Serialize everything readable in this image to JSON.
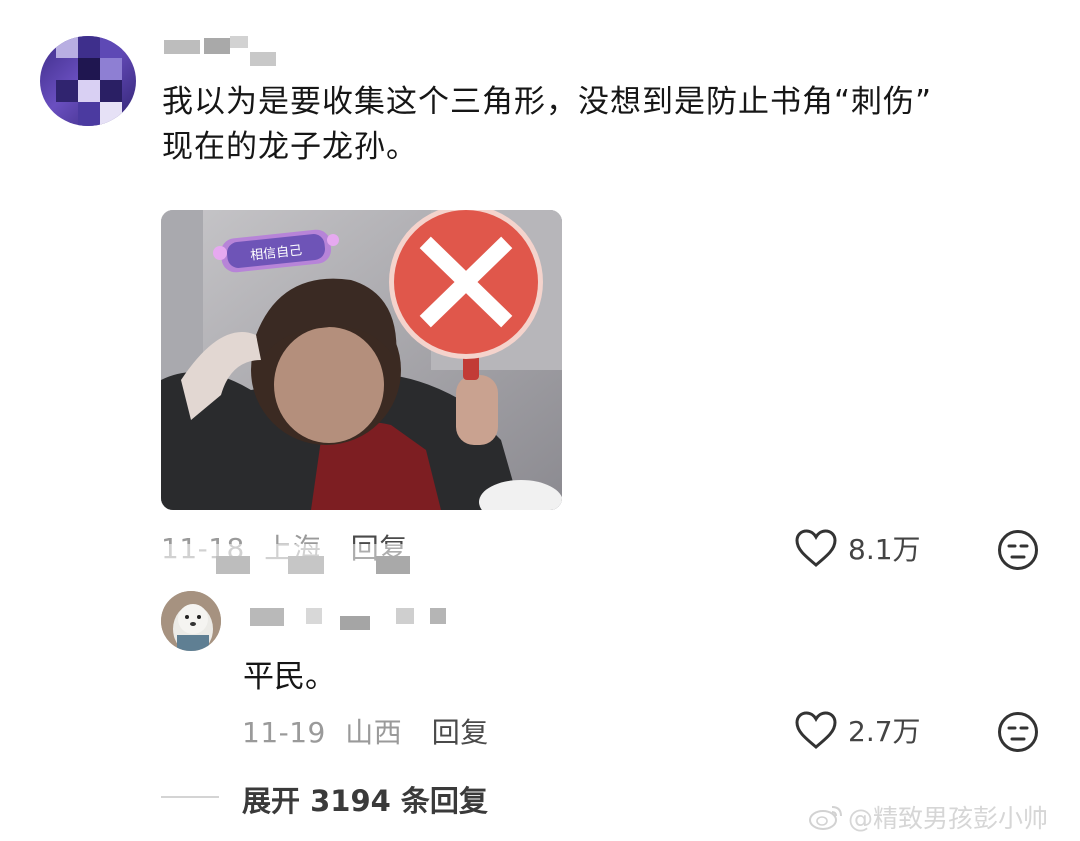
{
  "comment": {
    "text_line1": "我以为是要收集这个三角形，没想到是防止书角“刺伤”",
    "text_line2": "现在的龙子龙孙。",
    "date": "11-18",
    "location": "上海",
    "reply_label": "回复",
    "likes": "8.1万",
    "photo_badge_text": "相信自己"
  },
  "reply": {
    "text": "平民。",
    "date": "11-19",
    "location": "山西",
    "reply_label": "回复",
    "likes": "2.7万"
  },
  "expand": {
    "label": "展开 3194 条回复"
  },
  "watermark": {
    "text": "@精致男孩彭小帅"
  },
  "icons": {
    "like": "heart-icon",
    "dislike": "neutral-face-icon",
    "weibo": "weibo-logo-icon"
  },
  "colors": {
    "text_primary": "#161616",
    "text_meta": "#9a9a9a",
    "sign_red": "#e0574b"
  }
}
